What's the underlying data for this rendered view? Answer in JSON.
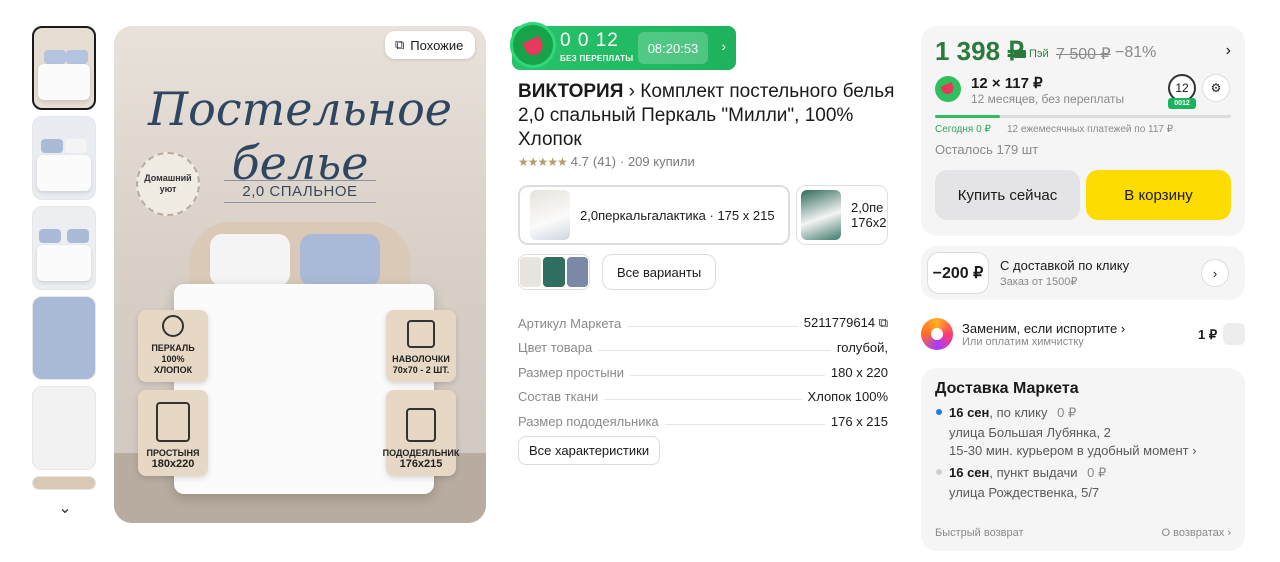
{
  "gallery": {
    "similar_label": "Похожие",
    "hero_title_line1": "Постельное",
    "hero_title_line2": "белье",
    "hero_subtitle": "2,0 СПАЛЬНОЕ",
    "cozy_badge": "Домашний уют",
    "badge_percale": [
      "ПЕРКАЛЬ",
      "100%",
      "ХЛОПОК"
    ],
    "badge_sheet": [
      "ПРОСТЫНЯ",
      "180x220"
    ],
    "badge_pillowcases": [
      "НАВОЛОЧКИ",
      "70x70 - 2 ШТ."
    ],
    "badge_duvet": [
      "ПОДОДЕЯЛЬНИК",
      "176x215"
    ]
  },
  "split": {
    "amount": "0 0 12",
    "caption": "БЕЗ ПЕРЕПЛАТЫ",
    "timer": "08:20:53"
  },
  "product": {
    "brand": "ВИКТОРИЯ",
    "title": "Комплект постельного белья 2,0 спальный Перкаль \"Милли\", 100% Хлопок",
    "stars": "★★★★★",
    "rating": "4.7",
    "reviews": "(41)",
    "bought": "· 209 купили"
  },
  "variants": {
    "selected_label": "2,0перкальгалактика · 175 x 215",
    "other_label_line1": "2,0пе",
    "other_label_line2": "176x2",
    "all_variants": "Все варианты"
  },
  "specs": {
    "rows": [
      {
        "k": "Артикул Маркета",
        "v": "5211779614 ⧉"
      },
      {
        "k": "Цвет товара",
        "v": "голубой,"
      },
      {
        "k": "Размер простыни",
        "v": "180 x 220"
      },
      {
        "k": "Состав ткани",
        "v": "Хлопок 100%"
      },
      {
        "k": "Размер пододеяльника",
        "v": "176 x 215"
      }
    ],
    "all_specs": "Все характеристики"
  },
  "buy": {
    "price": "1 398 ₽",
    "pay_label": "Пэй",
    "old_price": "7 500 ₽",
    "discount": "−81%",
    "split_main": "12 × 117 ₽",
    "split_sub": "12 месяцев, без переплаты",
    "split_badge": "12",
    "split_badge_tag": "0012",
    "split_progress": 0.22,
    "today": "Сегодня 0 ₽",
    "monthly": "12 ежемесячных платежей по 117 ₽",
    "stock": "Осталось 179 шт",
    "buy_now": "Купить сейчас",
    "to_cart": "В корзину"
  },
  "delivery_promo": {
    "chip": "−200 ₽",
    "line1": "С доставкой по клику",
    "line2": "Заказ от 1500₽"
  },
  "replace": {
    "line1": "Заменим, если испортите ›",
    "line2": "Или оплатим химчистку",
    "price": "1 ₽"
  },
  "market_delivery": {
    "title": "Доставка Маркета",
    "option1_date": "16 сен",
    "option1_type": ", по клику",
    "option1_price": "0 ₽",
    "option1_addr": "улица Большая Лубянка, 2",
    "option1_note": "15-30 мин. курьером в удобный момент ›",
    "option2_date": "16 сен",
    "option2_type": ", пункт выдачи",
    "option2_price": "0 ₽",
    "option2_addr": "улица Рождественка, 5/7",
    "return_left": "Быстрый возврат",
    "return_right": "О возвратах ›"
  },
  "colors": {
    "split_green": "#1db35c",
    "cart_yellow": "#ffdc00",
    "price_green": "#2a7a3a",
    "dot_blue": "#1f7ae8"
  }
}
